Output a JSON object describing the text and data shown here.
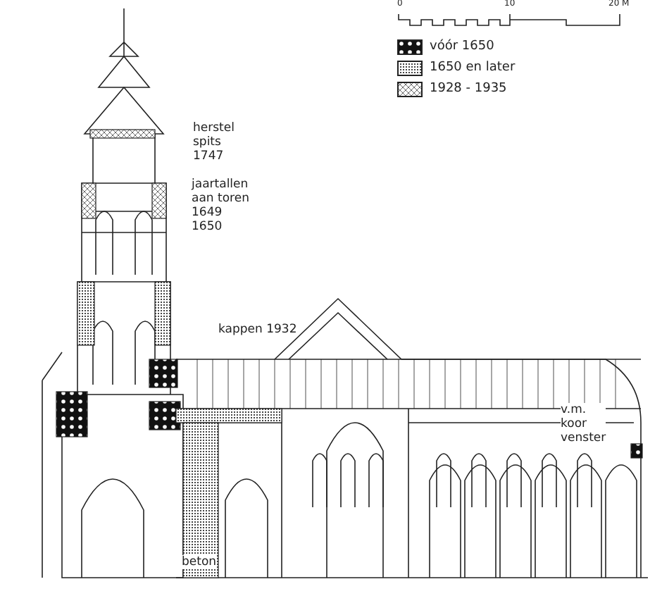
{
  "scale_bar": {
    "ticks": [
      "0",
      "10",
      "20 M"
    ]
  },
  "legend": [
    {
      "kind": "solid",
      "label": "vóór 1650"
    },
    {
      "kind": "dense",
      "label": "1650 en later"
    },
    {
      "kind": "open",
      "label": "1928 - 1935"
    }
  ],
  "annotations": [
    {
      "kind": "spire",
      "lines": [
        "herstel",
        "spits",
        "1747"
      ]
    },
    {
      "kind": "tower",
      "lines": [
        "jaartallen",
        "aan toren",
        "1649",
        "1650"
      ]
    },
    {
      "kind": "roof",
      "lines": [
        "kappen 1932"
      ]
    },
    {
      "kind": "choir",
      "lines": [
        "v.m.",
        "koor",
        "venster"
      ]
    },
    {
      "kind": "base",
      "lines": [
        "beton"
      ]
    }
  ]
}
